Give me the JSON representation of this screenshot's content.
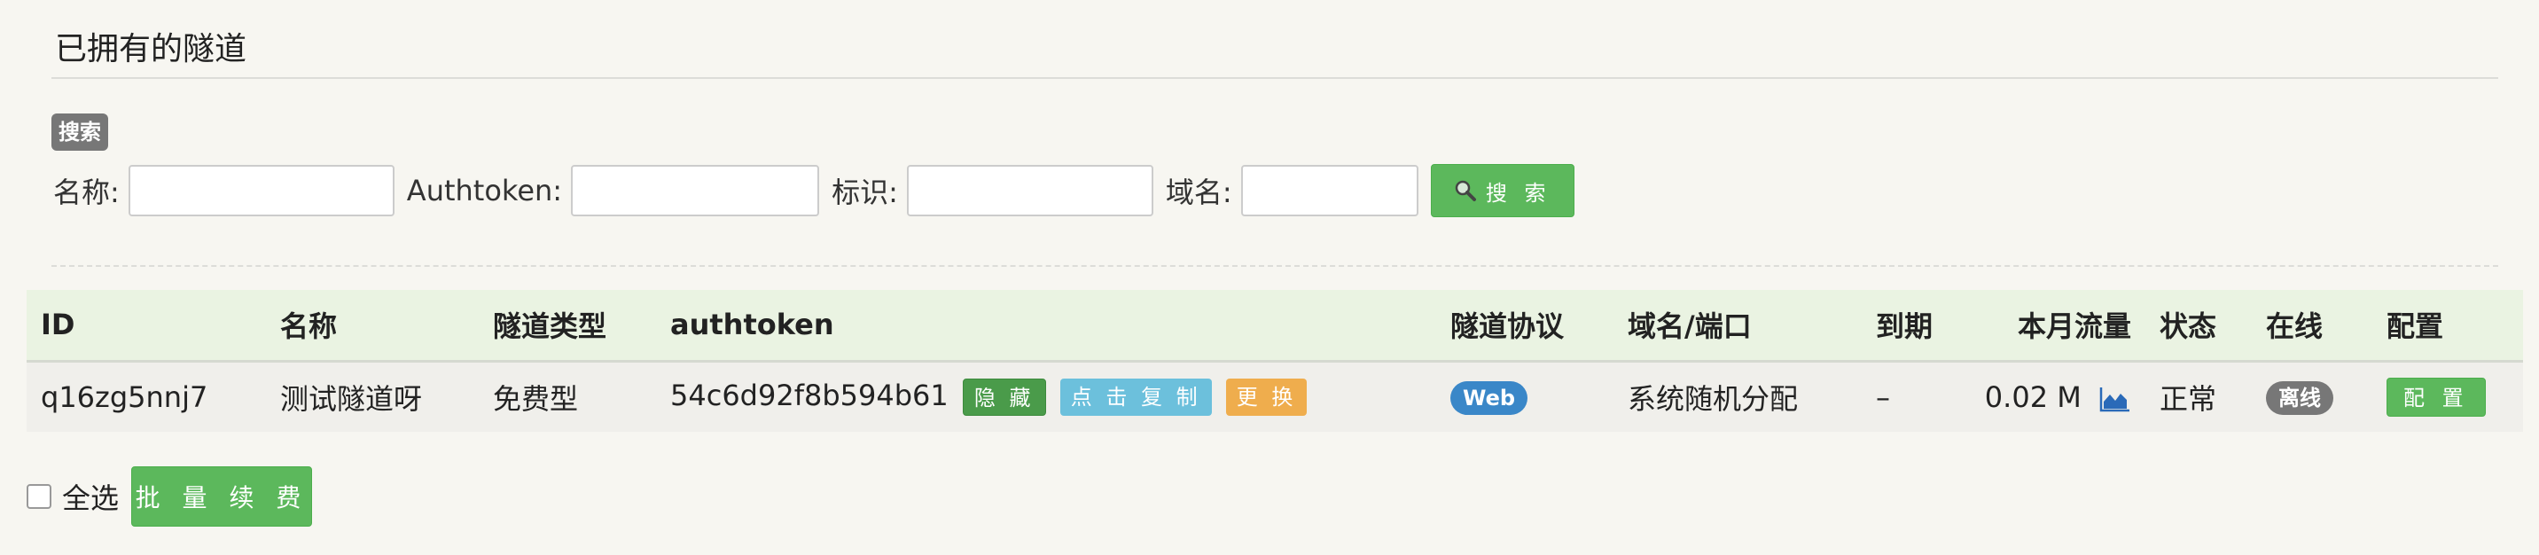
{
  "section": {
    "title": "已拥有的隧道",
    "search_badge": "搜索"
  },
  "search_form": {
    "name_label": "名称:",
    "authtoken_label": "Authtoken:",
    "identifier_label": "标识:",
    "domain_label": "域名:",
    "search_button": "搜 索"
  },
  "table": {
    "headers": {
      "id": "ID",
      "name": "名称",
      "tunnel_type": "隧道类型",
      "authtoken": "authtoken",
      "protocol": "隧道协议",
      "domain_port": "域名/端口",
      "expiry": "到期",
      "monthly_traffic": "本月流量",
      "status": "状态",
      "online": "在线",
      "config": "配置"
    },
    "rows": [
      {
        "id": "q16zg5nnj7",
        "name": "测试隧道呀",
        "tunnel_type": "免费型",
        "authtoken": "54c6d92f8b594b61",
        "hide_button": "隐 藏",
        "copy_button": "点 击 复 制",
        "change_button": "更 换",
        "protocol": "Web",
        "domain_port": "系统随机分配",
        "expiry": "–",
        "monthly_traffic": "0.02 M",
        "status": "正常",
        "online": "离线",
        "config_button": "配 置"
      }
    ]
  },
  "footer": {
    "select_all_label": "全选",
    "batch_renew_button": "批 量 续 费"
  },
  "colors": {
    "green": "#5cb85c",
    "dark_green": "#4a9b4a",
    "info": "#6cc0dc",
    "warning": "#efad4d",
    "primary": "#3a87c8",
    "gray": "#777777"
  }
}
